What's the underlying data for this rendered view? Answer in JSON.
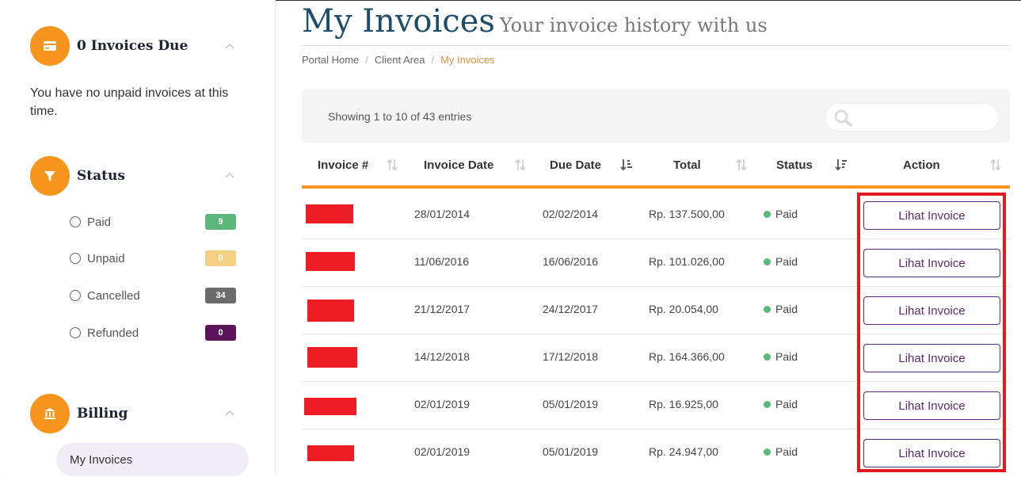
{
  "sidebar": {
    "invoices_due": {
      "title": "0 Invoices Due",
      "message": "You have no unpaid invoices at this time."
    },
    "status": {
      "title": "Status",
      "items": [
        {
          "label": "Paid",
          "count": "9",
          "color": "#5cb87a"
        },
        {
          "label": "Unpaid",
          "count": "0",
          "color": "#f5cf84"
        },
        {
          "label": "Cancelled",
          "count": "34",
          "color": "#6b6b6b"
        },
        {
          "label": "Refunded",
          "count": "0",
          "color": "#5b1459"
        }
      ]
    },
    "billing": {
      "title": "Billing",
      "active_item": "My Invoices"
    }
  },
  "page": {
    "title": "My Invoices",
    "subtitle": "Your invoice history with us"
  },
  "breadcrumb": [
    "Portal Home",
    "Client Area",
    "My Invoices"
  ],
  "table_info": "Showing 1 to 10 of 43 entries",
  "columns": [
    "Invoice #",
    "Invoice Date",
    "Due Date",
    "Total",
    "Status",
    "Action"
  ],
  "rows": [
    {
      "invoice_date": "28/01/2014",
      "due_date": "02/02/2014",
      "total": "Rp. 137.500,00",
      "status": "Paid",
      "action": "Lihat Invoice"
    },
    {
      "invoice_date": "11/06/2016",
      "due_date": "16/06/2016",
      "total": "Rp. 101.026,00",
      "status": "Paid",
      "action": "Lihat Invoice"
    },
    {
      "invoice_date": "21/12/2017",
      "due_date": "24/12/2017",
      "total": "Rp. 20.054,00",
      "status": "Paid",
      "action": "Lihat Invoice"
    },
    {
      "invoice_date": "14/12/2018",
      "due_date": "17/12/2018",
      "total": "Rp. 164.366,00",
      "status": "Paid",
      "action": "Lihat Invoice"
    },
    {
      "invoice_date": "02/01/2019",
      "due_date": "05/01/2019",
      "total": "Rp. 16.925,00",
      "status": "Paid",
      "action": "Lihat Invoice"
    },
    {
      "invoice_date": "02/01/2019",
      "due_date": "05/01/2019",
      "total": "Rp. 24.947,00",
      "status": "Paid",
      "action": "Lihat Invoice"
    }
  ],
  "colors": {
    "accent": "#f7941d",
    "title": "#1e4d6b",
    "button": "#5a2a6e",
    "paid": "#5bb879",
    "highlight": "#e21b23",
    "redaction": "#ee1c25"
  }
}
